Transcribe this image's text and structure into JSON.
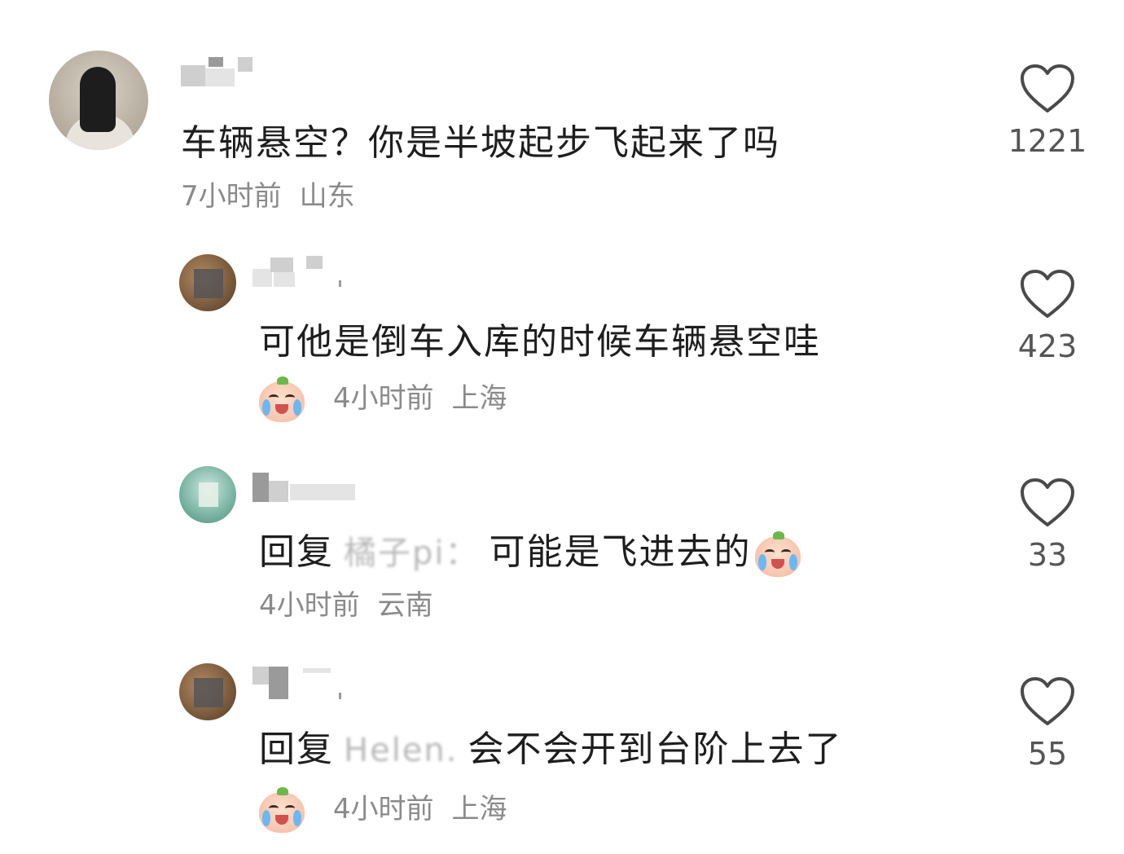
{
  "comments": [
    {
      "text": "车辆悬空？你是半坡起步飞起来了吗",
      "time": "7小时前",
      "location": "山东",
      "likes": "1221"
    },
    {
      "text": "可他是倒车入库的时候车辆悬空哇",
      "time": "4小时前",
      "location": "上海",
      "likes": "423"
    },
    {
      "reply_prefix": "回复",
      "reply_to": "橘子pi：",
      "text": "可能是飞进去的",
      "time": "4小时前",
      "location": "云南",
      "likes": "33"
    },
    {
      "reply_prefix": "回复",
      "reply_to": "Helen.",
      "text": "会不会开到台阶上去了",
      "time": "4小时前",
      "location": "上海",
      "likes": "55"
    }
  ],
  "icons": {
    "like": "heart-outline-icon",
    "emoji": "crying-laughing-peach-emoji"
  },
  "colors": {
    "text": "#1e1e1e",
    "meta": "#8a8a8a",
    "count": "#555555"
  }
}
